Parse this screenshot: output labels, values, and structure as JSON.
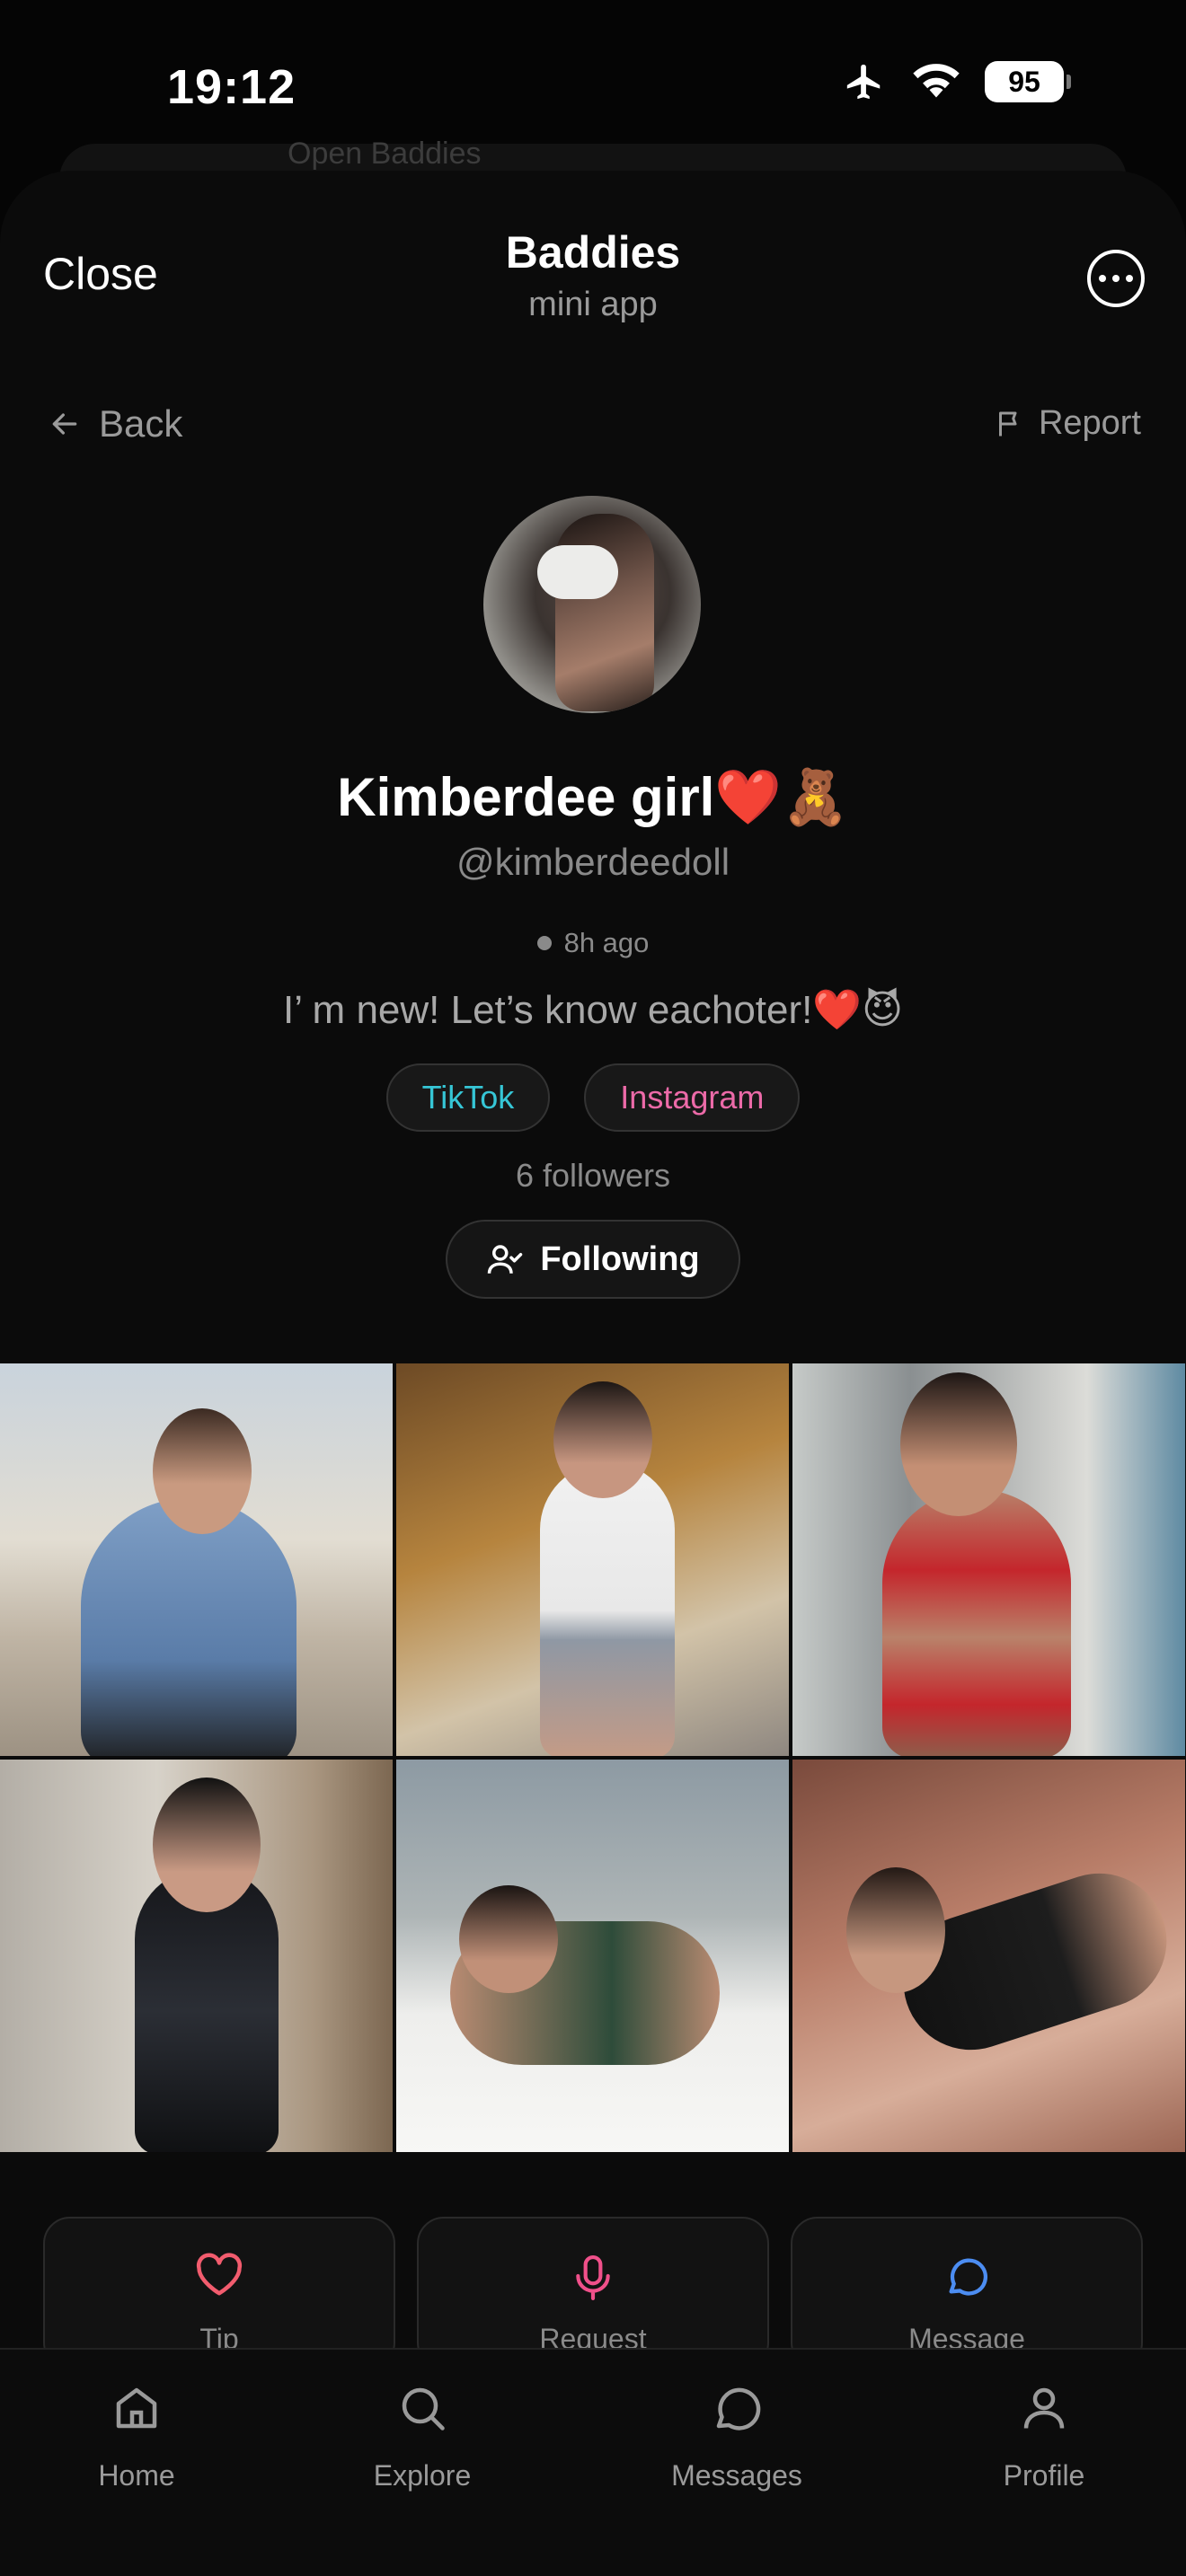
{
  "status_bar": {
    "time": "19:12",
    "battery": "95",
    "airplane_icon": "airplane-icon",
    "wifi_icon": "wifi-icon"
  },
  "background_sheet": {
    "label": "Open Baddies"
  },
  "mini_app": {
    "close_label": "Close",
    "title": "Baddies",
    "subtitle": "mini app",
    "more_icon": "more-icon"
  },
  "nav": {
    "back_label": "Back",
    "report_label": "Report"
  },
  "profile": {
    "display_name": "Kimberdee girl❤️🧸",
    "handle": "@kimberdeedoll",
    "last_seen": "8h ago",
    "bio": "I’ m new! Let’s know eachoter!❤️😈",
    "socials": [
      {
        "label": "TikTok",
        "color": "#36c6d6"
      },
      {
        "label": "Instagram",
        "color": "#ec6aa8"
      }
    ],
    "followers": "6 followers",
    "follow_button": "Following"
  },
  "posts": [
    {
      "scene": "outdoor-denim-jacket"
    },
    {
      "scene": "staircase-school-uniform"
    },
    {
      "scene": "red-bikini-doorway"
    },
    {
      "scene": "black-dress-bedroom"
    },
    {
      "scene": "bed-window-city"
    },
    {
      "scene": "canyon-rocks"
    }
  ],
  "actions": [
    {
      "label": "Tip",
      "icon": "heart-icon",
      "color": "#f25c6e"
    },
    {
      "label": "Request",
      "icon": "microphone-icon",
      "color": "#f0508a"
    },
    {
      "label": "Message",
      "icon": "chat-bubble-icon",
      "color": "#4c8df2"
    }
  ],
  "tabbar": [
    {
      "label": "Home",
      "icon": "home-icon"
    },
    {
      "label": "Explore",
      "icon": "search-icon"
    },
    {
      "label": "Messages",
      "icon": "chat-icon"
    },
    {
      "label": "Profile",
      "icon": "user-icon"
    }
  ]
}
